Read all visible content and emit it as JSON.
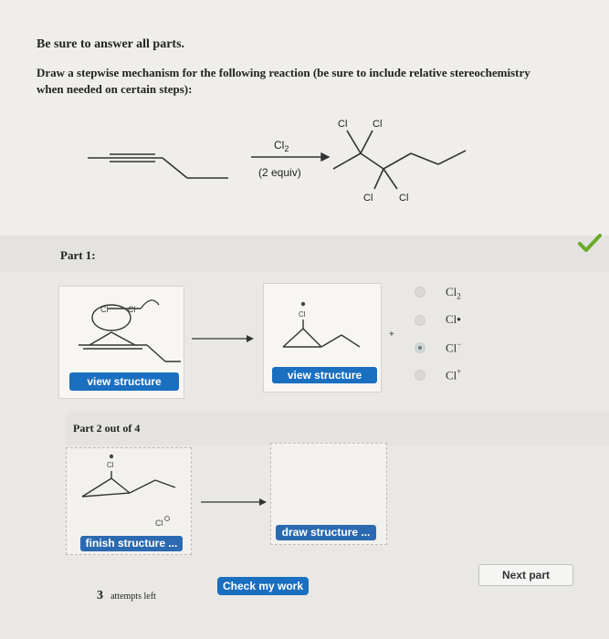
{
  "header": {
    "instruction": "Be sure to answer all parts.",
    "question_line1": "Draw a stepwise mechanism for the following reaction (be sure to include relative stereochemistry",
    "question_line2": "when needed on certain steps):"
  },
  "reaction": {
    "reagent": "Cl",
    "reagent_sub": "2",
    "conditions": "(2 equiv)",
    "product_cl_labels": [
      "Cl",
      "Cl",
      "Cl",
      "Cl"
    ]
  },
  "part1": {
    "title": "Part 1:",
    "structure1_label": "Cl",
    "structure1_label2": "Cl",
    "view_btn_1": "view structure",
    "view_btn_2": "view structure",
    "structure2_label": "Cl",
    "plus": "+",
    "options": [
      {
        "main": "Cl",
        "sub": "2",
        "sup": ""
      },
      {
        "main": "Cl",
        "sub": "",
        "sup": "•"
      },
      {
        "main": "Cl",
        "sub": "",
        "sup": "−"
      },
      {
        "main": "Cl",
        "sub": "",
        "sup": "+"
      }
    ],
    "selected_index": 2,
    "check_color": "#6aaa2a"
  },
  "part2": {
    "title": "Part 2 out of 4",
    "structure_label": "Cl",
    "ion_label": "Cl",
    "finish_btn": "finish structure ...",
    "draw_btn": "draw structure ..."
  },
  "footer": {
    "attempts_count": "3",
    "attempts_text": "attempts left",
    "check_btn": "Check my work",
    "next_btn": "Next part"
  }
}
